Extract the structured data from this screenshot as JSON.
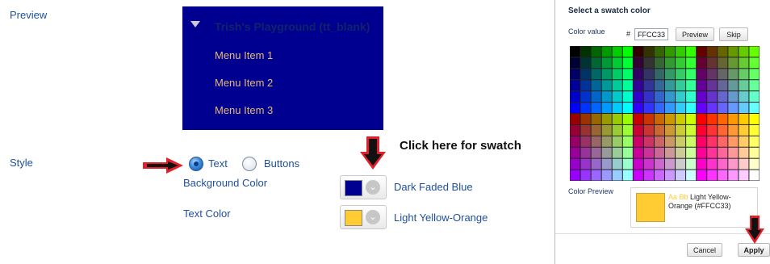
{
  "preview": {
    "label": "Preview",
    "title": "Trish's Playground (tt_blank)",
    "items": [
      "Menu Item 1",
      "Menu Item 2",
      "Menu Item 3"
    ]
  },
  "style": {
    "label": "Style",
    "options": [
      "Text",
      "Buttons"
    ],
    "selected": "Text",
    "click_hint": "Click here for swatch"
  },
  "colors": {
    "background": {
      "label": "Background Color",
      "value": "#000090",
      "name": "Dark Faded Blue"
    },
    "text": {
      "label": "Text Color",
      "value": "#FFCC33",
      "name": "Light Yellow-Orange"
    }
  },
  "dialog": {
    "title": "Select a swatch color",
    "color_value_label": "Color value",
    "hash": "#",
    "hex": "FFCC33",
    "preview_button": "Preview",
    "skip_button": "Skip",
    "color_preview_label": "Color Preview",
    "sample_aa": "Aa Bb",
    "sample_text": "Light Yellow-Orange (#FFCC33)",
    "cancel_button": "Cancel",
    "apply_button": "Apply"
  },
  "accent_colors": {
    "arrow_red": "#e0202a",
    "arrow_black": "#111111",
    "label_blue": "#1f4f9c"
  }
}
